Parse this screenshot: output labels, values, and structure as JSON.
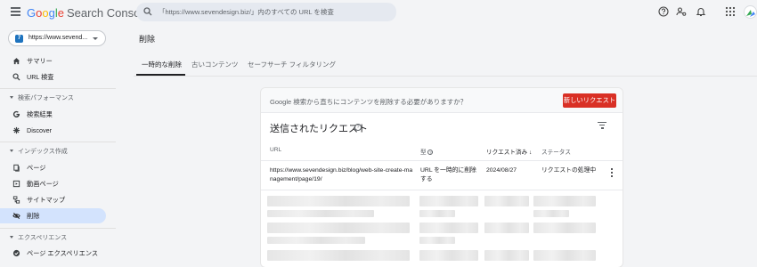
{
  "app": {
    "brand_letters": [
      "G",
      "o",
      "o",
      "g",
      "l",
      "e"
    ],
    "product": "Search Console",
    "search_placeholder": "「https://www.sevendesign.biz/」内のすべての URL を検査"
  },
  "colors": {
    "accent": "#d93025",
    "active_nav": "#d3e3fd",
    "brand_blue": "#4285f4"
  },
  "header_icons": [
    "help-icon",
    "admin-users-icon",
    "notifications-bell-icon",
    "apps-grid-icon"
  ],
  "sidebar": {
    "property": "https://www.sevend...",
    "property_favicon": "7",
    "items_top": [
      {
        "label": "サマリー",
        "icon": "home-icon"
      },
      {
        "label": "URL 検査",
        "icon": "search-icon"
      }
    ],
    "sections": [
      {
        "label": "検索パフォーマンス",
        "items": [
          {
            "label": "検索結果",
            "icon": "google-g-icon"
          },
          {
            "label": "Discover",
            "icon": "asterisk-icon"
          }
        ]
      },
      {
        "label": "インデックス作成",
        "items": [
          {
            "label": "ページ",
            "icon": "pages-icon"
          },
          {
            "label": "動画ページ",
            "icon": "video-page-icon"
          },
          {
            "label": "サイトマップ",
            "icon": "sitemap-icon"
          },
          {
            "label": "削除",
            "icon": "eye-off-icon",
            "active": true
          }
        ]
      },
      {
        "label": "エクスペリエンス",
        "items": [
          {
            "label": "ページ エクスペリエンス",
            "icon": "page-experience-icon"
          }
        ]
      }
    ]
  },
  "main": {
    "page_title": "削除",
    "tabs": [
      {
        "label": "一時的な削除",
        "active": true
      },
      {
        "label": "古いコンテンツ",
        "active": false
      },
      {
        "label": "セーフサーチ フィルタリング",
        "active": false
      }
    ],
    "banner_text": "Google 検索から直ちにコンテンツを削除する必要がありますか？",
    "new_request_label": "新しいリクエスト",
    "card_title": "送信されたリクエスト",
    "columns": [
      "URL",
      "型",
      "リクエスト済み",
      "ステータス"
    ],
    "rows": [
      {
        "url": "https://www.sevendesign.biz/blog/web-site-create-management/page/19/",
        "type": "URL を一時的に削除する",
        "requested": "2024/08/27",
        "status": "リクエストの処理中"
      }
    ]
  }
}
